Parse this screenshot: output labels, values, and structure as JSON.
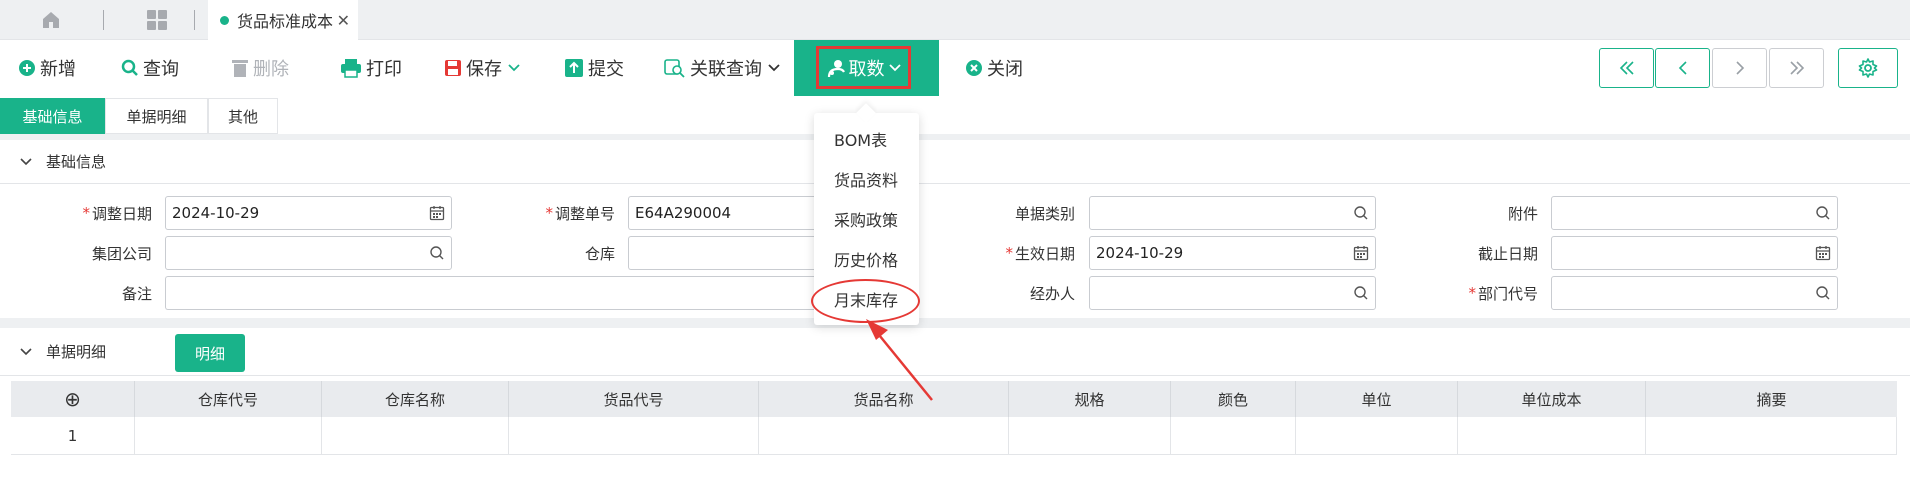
{
  "tabbar": {
    "doc_tab_label": "货品标准成本",
    "close_glyph": "✕"
  },
  "toolbar": {
    "add": "新增",
    "query": "查询",
    "delete": "删除",
    "print": "打印",
    "save": "保存",
    "submit": "提交",
    "linked_query": "关联查询",
    "fetch": "取数",
    "close": "关闭"
  },
  "subtabs": [
    "基础信息",
    "单据明细",
    "其他"
  ],
  "sections": {
    "basic": "基础信息",
    "detail": "单据明细",
    "detail_button": "明细"
  },
  "form": {
    "adjust_date_label": "调整日期",
    "adjust_date_value": "2024-10-29",
    "adjust_no_label": "调整单号",
    "adjust_no_value": "E64A290004",
    "doc_type_label": "单据类别",
    "attachment_label": "附件",
    "group_company_label": "集团公司",
    "warehouse_label": "仓库",
    "effective_date_label": "生效日期",
    "effective_date_value": "2024-10-29",
    "end_date_label": "截止日期",
    "remark_label": "备注",
    "handler_label": "经办人",
    "dept_code_label": "部门代号"
  },
  "dropdown": {
    "items": [
      "BOM表",
      "货品资料",
      "采购政策",
      "历史价格",
      "月末库存"
    ],
    "highlighted": "月末库存"
  },
  "grid": {
    "add_glyph": "⊕",
    "columns": [
      "仓库代号",
      "仓库名称",
      "货品代号",
      "货品名称",
      "规格",
      "颜色",
      "单位",
      "单位成本",
      "摘要"
    ],
    "rows": [
      {
        "index": "1"
      }
    ]
  },
  "colors": {
    "accent": "#19b38a",
    "annotation": "#e53935"
  }
}
